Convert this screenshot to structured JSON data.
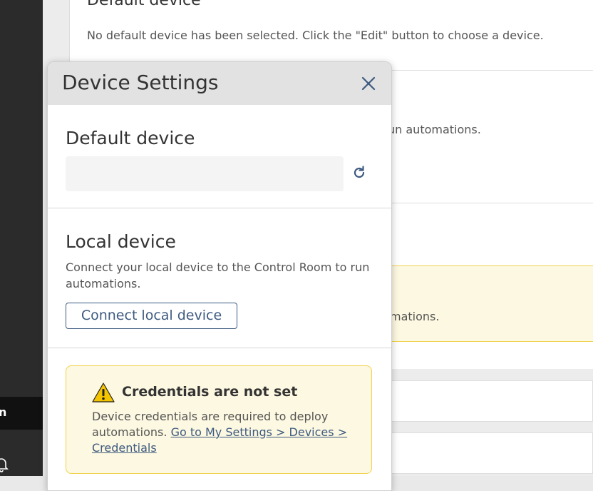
{
  "background": {
    "panel_title": "Default device",
    "panel_text": "No default device has been selected. Click the \"Edit\" button to choose a device.",
    "partial_text_1": "un automations.",
    "partial_text_2": "mations."
  },
  "sidebar": {
    "active_item_fragment": "n"
  },
  "modal": {
    "title": "Device Settings",
    "close_icon": "close-icon",
    "default_device": {
      "heading": "Default device",
      "value": "",
      "refresh_icon": "refresh-icon"
    },
    "local_device": {
      "heading": "Local device",
      "description": "Connect your local device to the Control Room to run automations.",
      "connect_label": "Connect local device"
    },
    "credentials": {
      "title": "Credentials are not set",
      "text": "Device credentials are required to deploy automations.",
      "link_label": "Go to My Settings > Devices > Credentials",
      "icon": "warning-icon"
    }
  },
  "colors": {
    "accent": "#3d5a80",
    "warning_bg": "#fdf8e1",
    "warning_border": "#f2d24c",
    "sidebar": "#2b2b2b"
  }
}
